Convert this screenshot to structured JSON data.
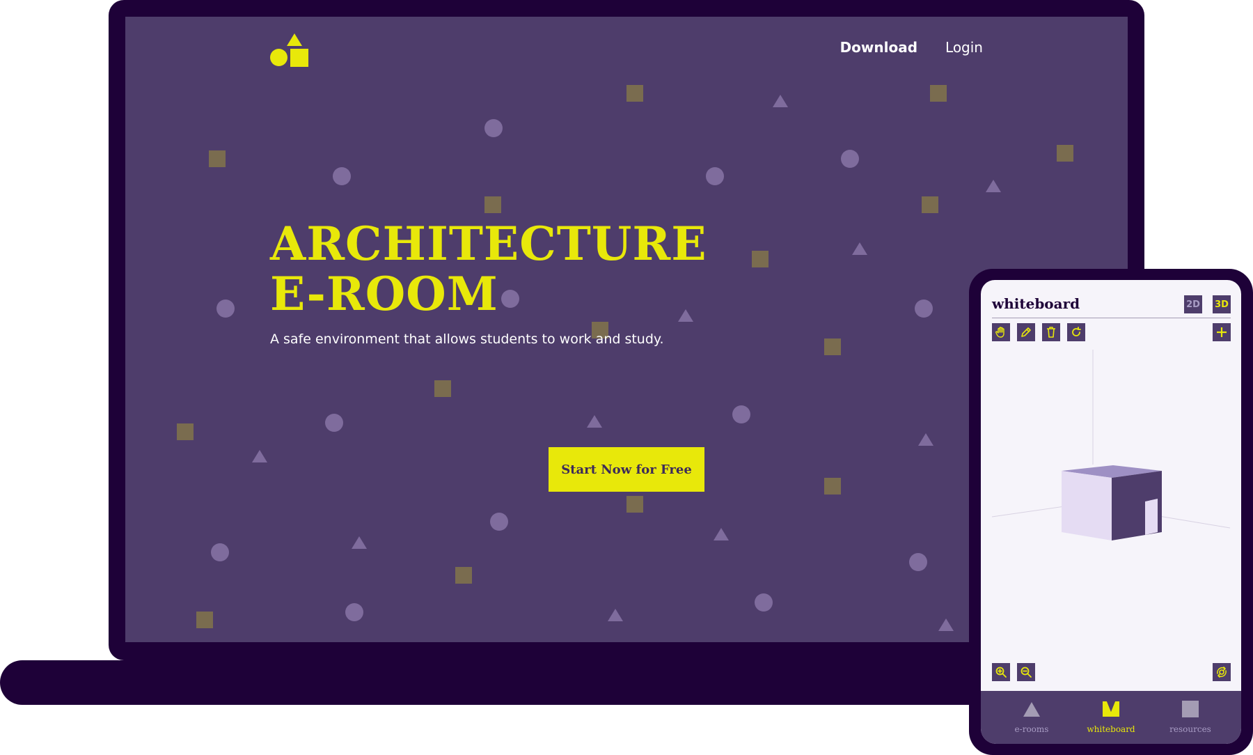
{
  "colors": {
    "accent": "#e8e80a",
    "screen_bg": "#4e3d6b",
    "frame": "#1e0138",
    "phone_bg": "#f6f4fa"
  },
  "site": {
    "logo_icon": "shapes-logo-icon",
    "nav": {
      "download": "Download",
      "login": "Login"
    },
    "hero": {
      "title_line1": "ARCHITECTURE",
      "title_line2": "E-ROOM",
      "subtitle": "A safe environment that allows students to work and study."
    },
    "cta_label": "Start Now for Free"
  },
  "app": {
    "title": "whiteboard",
    "mode_2d": "2D",
    "mode_3d": "3D",
    "active_mode": "3D",
    "tools": [
      "hand-icon",
      "pencil-icon",
      "trash-icon",
      "rotate-icon",
      "plus-icon"
    ],
    "zoom_tools": [
      "zoom-in-icon",
      "zoom-out-icon",
      "orbit-icon"
    ],
    "tabs": [
      {
        "label": "e-rooms",
        "icon": "triangle-icon",
        "active": false
      },
      {
        "label": "whiteboard",
        "icon": "easel-icon",
        "active": true
      },
      {
        "label": "resources",
        "icon": "square-icon",
        "active": false
      }
    ]
  }
}
